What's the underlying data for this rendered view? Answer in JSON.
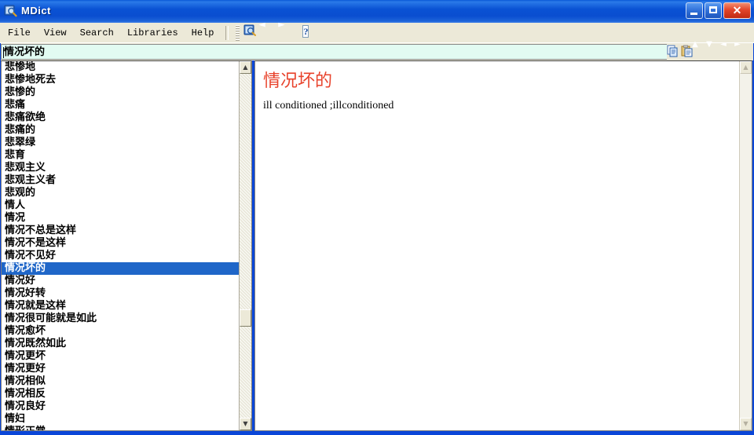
{
  "window": {
    "title": "MDict",
    "icon": "dictionary-magnifier-icon",
    "controls": {
      "minimize": "–",
      "maximize": "□",
      "close": "✕"
    }
  },
  "menu": {
    "items": [
      {
        "label": "File"
      },
      {
        "label": "View"
      },
      {
        "label": "Search"
      },
      {
        "label": "Libraries"
      },
      {
        "label": "Help"
      }
    ]
  },
  "toolbar": {
    "buttons": [
      {
        "name": "dictionary-search-icon",
        "glyph": ""
      },
      {
        "name": "back-arrow-icon",
        "glyph": "◄"
      },
      {
        "name": "forward-arrow-icon",
        "glyph": "►"
      },
      {
        "name": "help-icon",
        "glyph": "?"
      }
    ]
  },
  "search": {
    "value": "情况坏的",
    "placeholder": "",
    "tools": [
      {
        "name": "copy-icon",
        "glyph": ""
      },
      {
        "name": "paste-icon",
        "glyph": ""
      },
      {
        "name": "scroll-up-icon",
        "glyph": "▲"
      },
      {
        "name": "scroll-down-icon",
        "glyph": "▼"
      },
      {
        "name": "history-back-icon",
        "glyph": "◄"
      },
      {
        "name": "history-forward-icon",
        "glyph": "►"
      }
    ]
  },
  "word_list": {
    "selected": "情况坏的",
    "items": [
      "悲惨地",
      "悲惨地死去",
      "悲惨的",
      "悲痛",
      "悲痛欲绝",
      "悲痛的",
      "悲翠绿",
      "悲育",
      "悲观主义",
      "悲观主义者",
      "悲观的",
      "情人",
      "情况",
      "情况不总是这样",
      "情况不是这样",
      "情况不见好",
      "情况坏的",
      "情况好",
      "情况好转",
      "情况就是这样",
      "情况很可能就是如此",
      "情况愈坏",
      "情况既然如此",
      "情况更坏",
      "情况更好",
      "情况相似",
      "情况相反",
      "情况良好",
      "情妇",
      "情形正常"
    ],
    "scrollbar": {
      "up_glyph": "▲",
      "down_glyph": "▼"
    }
  },
  "content": {
    "headword": "情况坏的",
    "definition": "ill conditioned ;illconditioned",
    "scrollbar": {
      "up_glyph": "▲",
      "down_glyph": "▼"
    }
  },
  "colors": {
    "title_bar": "#0a52d4",
    "menu_bg": "#ece9d8",
    "search_bg": "#e2fbf2",
    "selection": "#1f66c8",
    "headword": "#e8432c"
  }
}
